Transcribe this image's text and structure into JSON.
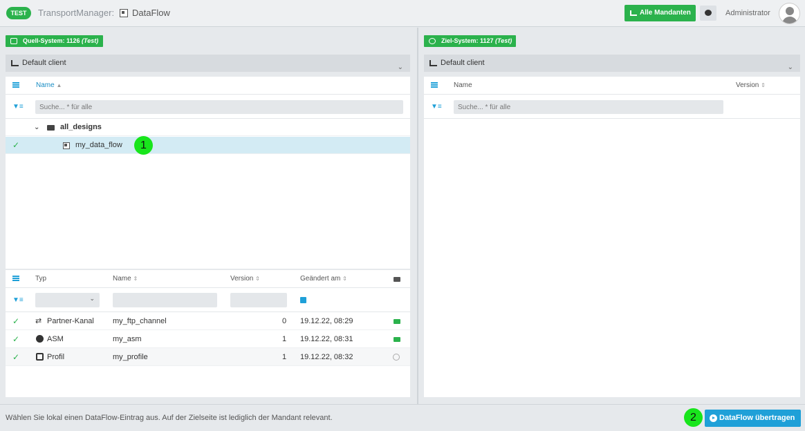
{
  "topbar": {
    "env_badge": "TEST",
    "app_title": "TransportManager:",
    "app_page": "DataFlow",
    "all_clients_label": "Alle Mandanten",
    "user_name": "Administrator"
  },
  "source": {
    "label_prefix": "Quell-System: 1126 ",
    "label_env": "(Test)",
    "client": "Default client",
    "tree": {
      "col_name": "Name",
      "search_placeholder": "Suche... * für alle",
      "folder": "all_designs",
      "item": "my_data_flow"
    },
    "list": {
      "columns": {
        "type": "Typ",
        "name": "Name",
        "version": "Version",
        "changed": "Geändert am"
      },
      "rows": [
        {
          "type": "Partner-Kanal",
          "name": "my_ftp_channel",
          "version": "0",
          "changed": "19.12.22, 08:29",
          "transport": "truck"
        },
        {
          "type": "ASM",
          "name": "my_asm",
          "version": "1",
          "changed": "19.12.22, 08:31",
          "transport": "truck"
        },
        {
          "type": "Profil",
          "name": "my_profile",
          "version": "1",
          "changed": "19.12.22, 08:32",
          "transport": "blocked"
        }
      ]
    }
  },
  "target": {
    "label_prefix": "Ziel-System: 1127 ",
    "label_env": "(Test)",
    "client": "Default client",
    "col_name": "Name",
    "col_version": "Version",
    "search_placeholder": "Suche... * für alle"
  },
  "footer": {
    "hint": "Wählen Sie lokal einen DataFlow-Eintrag aus. Auf der Zielseite ist lediglich der Mandant relevant.",
    "transfer_label": "DataFlow übertragen"
  },
  "markers": {
    "first": "1",
    "second": "2"
  },
  "colors": {
    "accent_green": "#2bb24c",
    "accent_blue": "#1fa0d8",
    "marker_green": "#18e51c"
  }
}
